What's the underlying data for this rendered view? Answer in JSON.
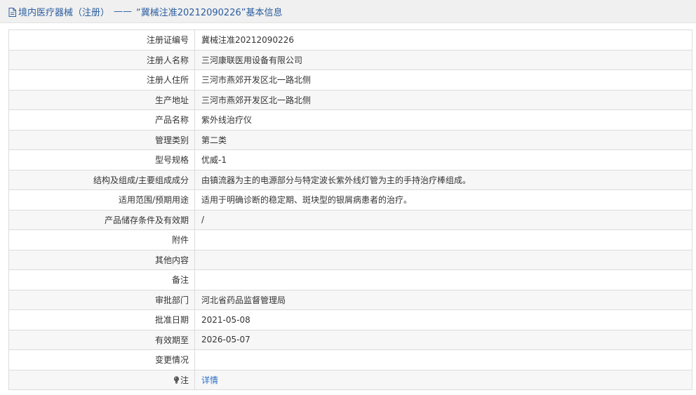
{
  "header": {
    "section": "境内医疗器械（注册）",
    "separator": "——",
    "title": "“冀械注准20212090226”基本信息"
  },
  "rows": [
    {
      "label": "注册证编号",
      "value": "冀械注准20212090226"
    },
    {
      "label": "注册人名称",
      "value": "三河康联医用设备有限公司"
    },
    {
      "label": "注册人住所",
      "value": "三河市燕郊开发区北一路北侧"
    },
    {
      "label": "生产地址",
      "value": "三河市燕郊开发区北一路北侧"
    },
    {
      "label": "产品名称",
      "value": "紫外线治疗仪"
    },
    {
      "label": "管理类别",
      "value": "第二类"
    },
    {
      "label": "型号规格",
      "value": "优威-1"
    },
    {
      "label": "结构及组成/主要组成成分",
      "value": "由镇流器为主的电源部分与特定波长紫外线灯管为主的手持治疗棒组成。"
    },
    {
      "label": "适用范围/预期用途",
      "value": "适用于明确诊断的稳定期、斑块型的银屑病患者的治疗。"
    },
    {
      "label": "产品储存条件及有效期",
      "value": "/"
    },
    {
      "label": "附件",
      "value": ""
    },
    {
      "label": "其他内容",
      "value": ""
    },
    {
      "label": "备注",
      "value": ""
    },
    {
      "label": "审批部门",
      "value": "河北省药品监督管理局"
    },
    {
      "label": "批准日期",
      "value": "2021-05-08"
    },
    {
      "label": "有效期至",
      "value": "2026-05-07"
    },
    {
      "label": "变更情况",
      "value": ""
    }
  ],
  "note": {
    "label": "注",
    "icon": "bulb-icon",
    "link": "详情"
  },
  "colors": {
    "link": "#2a6fc9",
    "header_text": "#2a5d9f",
    "header_bg": "#f0f0f0",
    "border": "#dcdcdc"
  }
}
